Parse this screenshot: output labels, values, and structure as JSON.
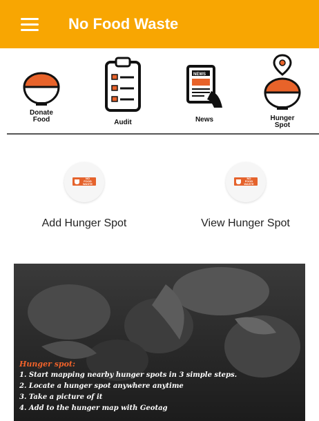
{
  "appbar": {
    "title": "No Food Waste",
    "color": "#f8a602"
  },
  "nav": [
    {
      "label_line1": "Donate",
      "label_line2": "Food",
      "icon": "food-bowl-icon"
    },
    {
      "label_line1": "Audit",
      "label_line2": "",
      "icon": "clipboard-checklist-icon"
    },
    {
      "label_line1": "News",
      "label_line2": "",
      "icon": "newspaper-icon"
    },
    {
      "label_line1": "Hunger",
      "label_line2": "Spot",
      "icon": "hunger-spot-pin-icon"
    }
  ],
  "actions": {
    "add_label": "Add Hunger Spot",
    "view_label": "View Hunger Spot",
    "logo_text": "NO FOOD WASTE"
  },
  "banner": {
    "title": "Hunger spot:",
    "lines": [
      "1. Start mapping nearby hunger spots in 3 simple steps.",
      "2. Locate a hunger spot anywhere anytime",
      "3. Take a picture of it",
      "4. Add to the hunger map with Geotag"
    ]
  },
  "colors": {
    "accent": "#f8a602",
    "bowl": "#e8632a",
    "logo": "#e5632c"
  }
}
